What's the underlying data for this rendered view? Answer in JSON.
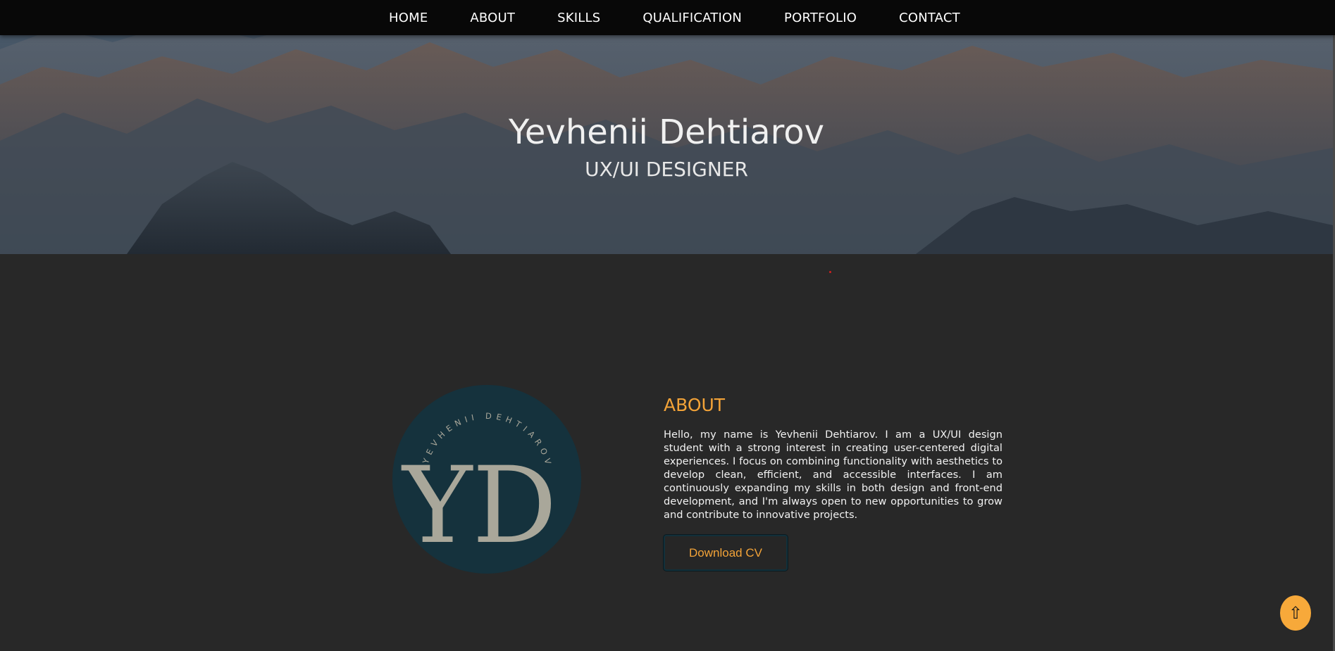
{
  "nav": {
    "items": [
      "HOME",
      "ABOUT",
      "SKILLS",
      "QUALIFICATION",
      "PORTFOLIO",
      "CONTACT"
    ]
  },
  "hero": {
    "title": "Yevhenii Dehtiarov",
    "subtitle": "UX/UI DESIGNER"
  },
  "about": {
    "heading": "ABOUT",
    "text": "Hello, my name is Yevhenii Dehtiarov. I am a UX/UI design student with a strong interest in creating user-centered digital experiences. I focus on combining functionality with aesthetics to develop clean, efficient, and accessible interfaces. I am continuously expanding my skills in both design and front-end development, and I'm always open to new opportunities to grow and contribute to innovative projects.",
    "button_label": "Download CV",
    "logo": {
      "ring_text": "YEVHENII DEHTIAROV",
      "monogram": "YD"
    }
  },
  "scroll_top": {
    "icon": "⇧"
  },
  "colors": {
    "accent": "#f3a338",
    "background": "#282828",
    "nav_background": "#080808",
    "logo_circle": "#15323d",
    "logo_text": "#a9a79a"
  }
}
